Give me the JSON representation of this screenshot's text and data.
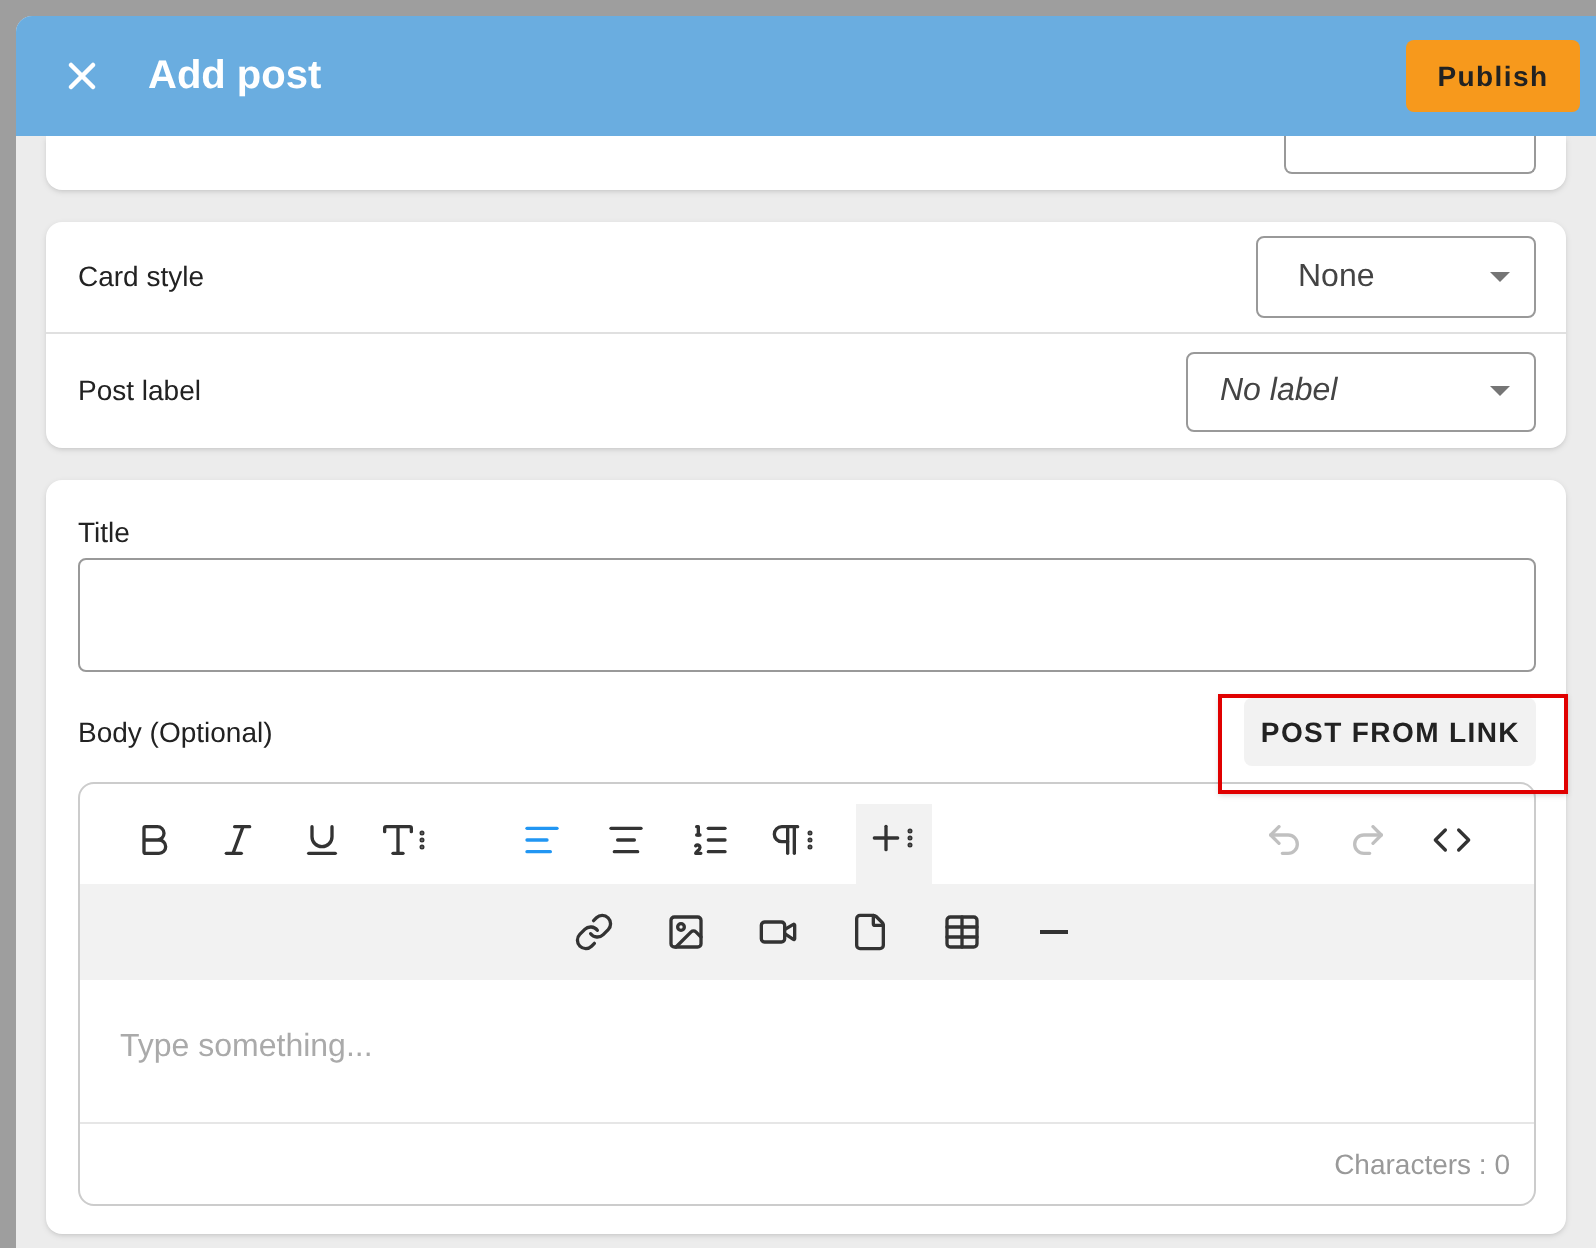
{
  "header": {
    "title": "Add post",
    "publish": "Publish"
  },
  "card_style": {
    "label": "Card style",
    "value": "None"
  },
  "post_label": {
    "label": "Post label",
    "value": "No label"
  },
  "title_field": {
    "label": "Title"
  },
  "body": {
    "label": "Body (Optional)",
    "post_from_link": "POST FROM LINK",
    "highlighted": true,
    "placeholder": "Type something...",
    "counter": "Characters : 0"
  },
  "toolbar": [
    {
      "selected": false,
      "disabled": false
    },
    {
      "selected": false,
      "disabled": false
    },
    {
      "selected": false,
      "disabled": false
    },
    {
      "selected": false,
      "disabled": false
    },
    {
      "selected": true,
      "disabled": false
    },
    {
      "selected": false,
      "disabled": false
    },
    {
      "selected": false,
      "disabled": false
    },
    {
      "selected": false,
      "disabled": false
    },
    {
      "selected": true,
      "disabled": false
    },
    {
      "selected": false,
      "disabled": true
    },
    {
      "selected": false,
      "disabled": true
    },
    {
      "selected": false,
      "disabled": false
    }
  ]
}
